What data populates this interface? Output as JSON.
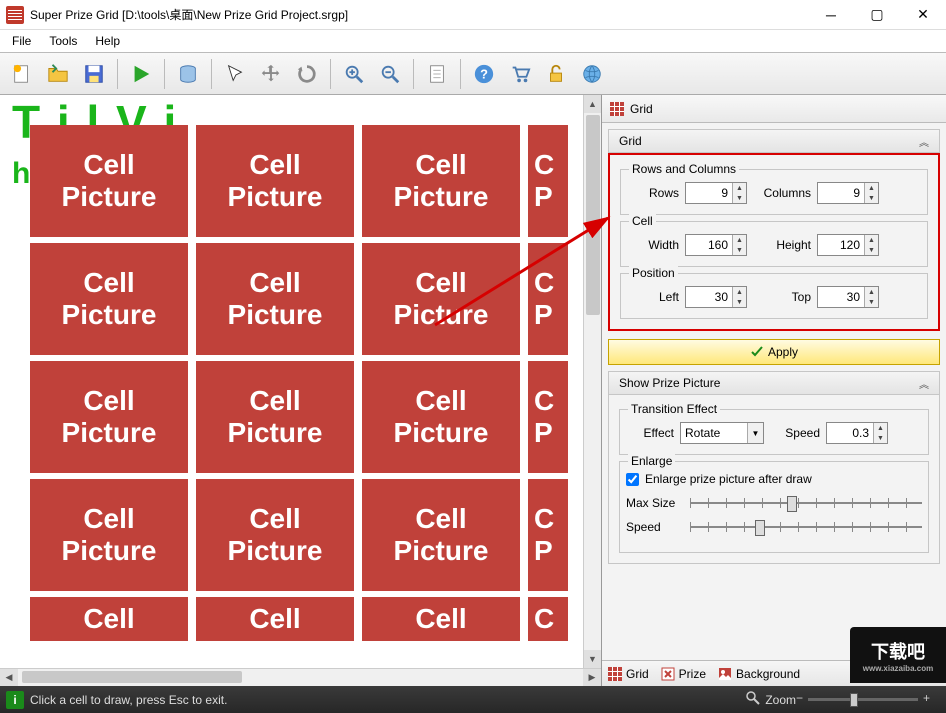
{
  "window": {
    "title": "Super Prize Grid [D:\\tools\\桌面\\New Prize Grid Project.srgp]"
  },
  "menu": {
    "items": [
      "File",
      "Tools",
      "Help"
    ]
  },
  "canvas": {
    "bg_top": "T   i   l V       i",
    "bg_sub": "ht",
    "cell_text1": "Cell",
    "cell_text2": "Picture",
    "cell_text_partial": "P",
    "rows_visible": 5,
    "cols_visible": 4
  },
  "panel": {
    "title": "Grid",
    "sec_grid": "Grid",
    "grp_rowscols": "Rows and Columns",
    "lbl_rows": "Rows",
    "val_rows": "9",
    "lbl_cols": "Columns",
    "val_cols": "9",
    "grp_cell": "Cell",
    "lbl_width": "Width",
    "val_width": "160",
    "lbl_height": "Height",
    "val_height": "120",
    "grp_pos": "Position",
    "lbl_left": "Left",
    "val_left": "30",
    "lbl_top": "Top",
    "val_top": "30",
    "btn_apply": "Apply",
    "sec_show": "Show Prize Picture",
    "grp_trans": "Transition Effect",
    "lbl_effect": "Effect",
    "val_effect": "Rotate",
    "lbl_speed": "Speed",
    "val_speed": "0.3",
    "grp_enlarge": "Enlarge",
    "chk_enlarge": "Enlarge prize picture after draw",
    "lbl_max": "Max Size",
    "tabs": {
      "grid": "Grid",
      "prize": "Prize",
      "background": "Background"
    }
  },
  "statusbar": {
    "hint": "Click a cell to draw, press Esc to exit.",
    "zoom_label": "Zoom"
  },
  "watermark": {
    "line1": "下载吧",
    "line2": "www.xiazaiba.com"
  }
}
